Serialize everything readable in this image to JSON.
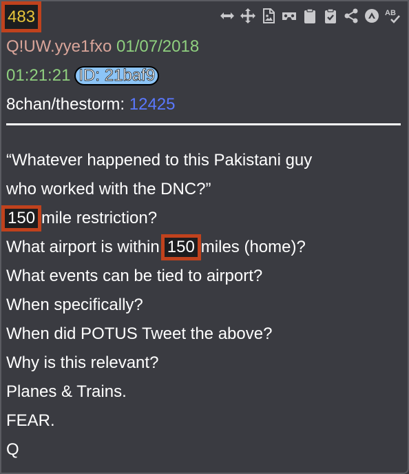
{
  "post": {
    "number": "483",
    "author": "Q!UW.yye1fxo",
    "date": "01/07/2018",
    "time": "01:21:21",
    "id_label": "ID: 21baf9",
    "board_prefix": "8chan/thestorm:",
    "thread_number": "12425"
  },
  "toolbar": {
    "icons": [
      "resize-icon",
      "move-icon",
      "image-file-icon",
      "vr-glasses-icon",
      "clipboard-icon",
      "clipboard-check-icon",
      "share-icon",
      "up-arrow-circle-icon",
      "spellcheck-icon"
    ]
  },
  "body": {
    "line1": "“Whatever happened to this Pakistani guy",
    "line2": "who worked with the DNC?”",
    "line3_highlight": "150",
    "line3_rest": "mile restriction?",
    "line4_pre": "What airport is within",
    "line4_highlight": "150",
    "line4_post": "miles (home)?",
    "line5": "What events can be tied to airport?",
    "line6": "When specifically?",
    "line7": "When did POTUS Tweet the above?",
    "line8": "Why is this relevant?",
    "line9": "Planes & Trains.",
    "line10": "FEAR.",
    "line11": "Q"
  },
  "colors": {
    "background": "#3a3b41",
    "highlight_border": "#c0421d",
    "number": "#e8c53a",
    "author": "#d9a59a",
    "date": "#8fd07f",
    "link": "#5a78ff",
    "id_badge": "#8cc4f6"
  }
}
